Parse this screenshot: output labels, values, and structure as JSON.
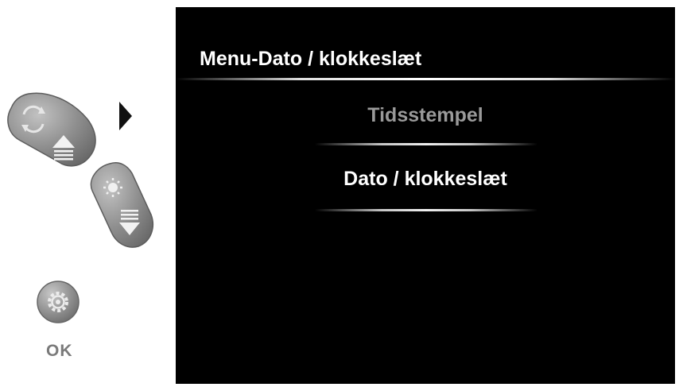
{
  "controls": {
    "up_button_icons": [
      "cycle-arrows-icon",
      "scroll-up-icon"
    ],
    "down_button_icons": [
      "brightness-icon",
      "scroll-down-icon"
    ],
    "ok_button_icon": "gear-icon",
    "ok_label": "OK",
    "pointer_icon": "triangle-right-icon"
  },
  "screen": {
    "title": "Menu-Dato / klokkeslæt",
    "items": [
      {
        "label": "Tidsstempel",
        "state": "dimmed"
      },
      {
        "label": "Dato / klokkeslæt",
        "state": "highlighted"
      }
    ]
  },
  "colors": {
    "screen_background": "#000000",
    "title_text": "#ffffff",
    "dimmed_item_text": "#9a9a9a",
    "highlighted_item_text": "#ffffff",
    "button_gray": "#8c8c8c",
    "ok_label": "#7a7a7a"
  }
}
